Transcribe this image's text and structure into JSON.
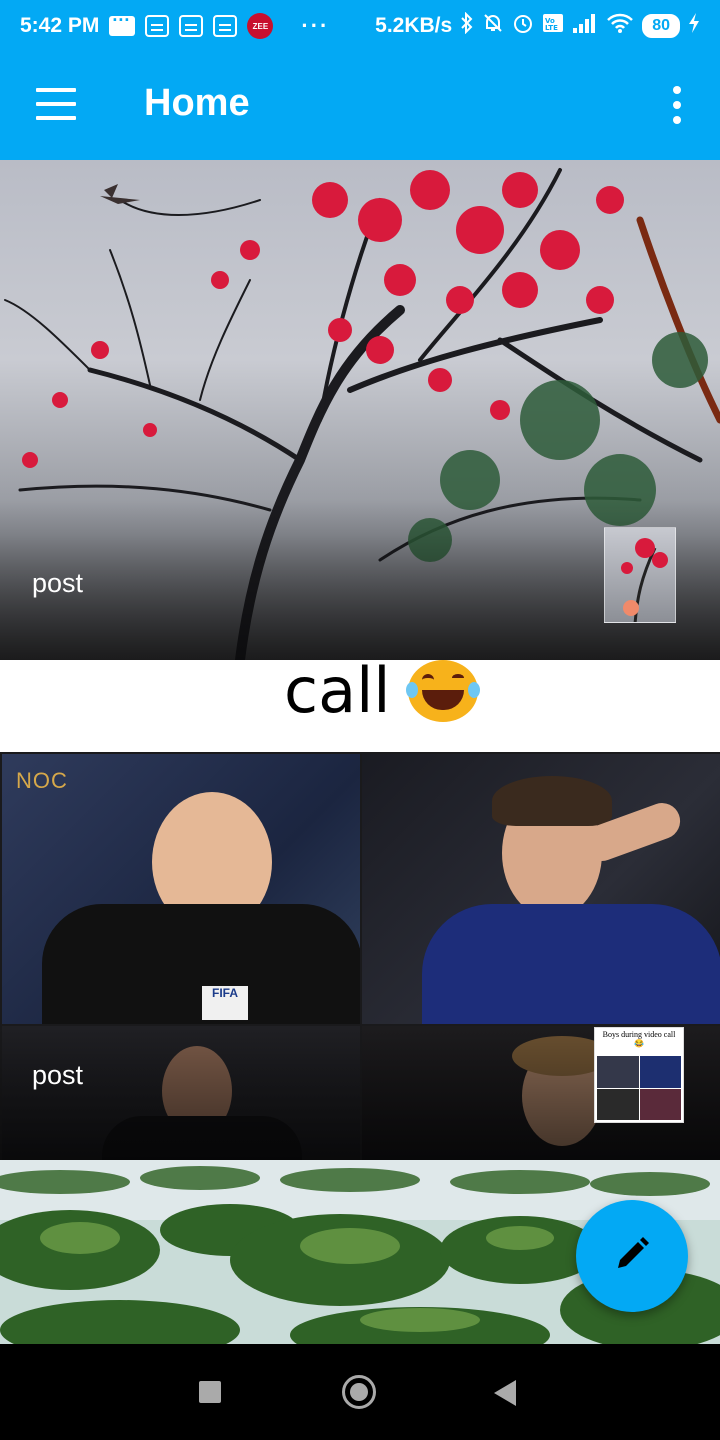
{
  "status_bar": {
    "time": "5:42 PM",
    "zee_label": "ZEE",
    "overflow": "···",
    "net_speed": "5.2KB/s",
    "battery": "80",
    "icons": [
      "chat-icon",
      "sim-notif-icon",
      "sim-notif-icon",
      "sim-notif-icon",
      "zee-icon",
      "bluetooth-icon",
      "mute-bell-icon",
      "alarm-icon",
      "volte-icon",
      "signal-icon",
      "wifi-icon",
      "battery-icon",
      "charging-icon"
    ]
  },
  "app_bar": {
    "title": "Home",
    "color": "#03A9F4"
  },
  "feed": {
    "posts": [
      {
        "label": "post",
        "image": "red-blossom-tree"
      },
      {
        "caption": "call",
        "emoji": "face-with-tears-of-joy"
      },
      {
        "label": "post",
        "overlay_text": "NOC",
        "thumb_caption": "Boys during video call 😂"
      },
      {
        "image": "green-islands-bay"
      }
    ]
  },
  "fab": {
    "icon": "pencil-icon"
  },
  "nav_bar": {
    "icons": [
      "recent-apps-icon",
      "home-icon",
      "back-icon"
    ]
  }
}
